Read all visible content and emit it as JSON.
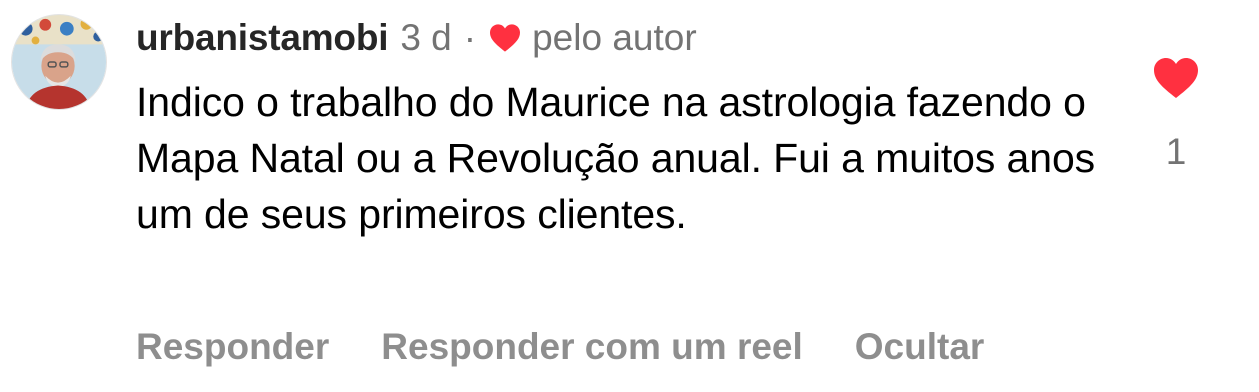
{
  "comment": {
    "username": "urbanistamobi",
    "time": "3 d",
    "separator": "·",
    "author_liked_label": "pelo autor",
    "text": "Indico o trabalho do Maurice na astrologia fazendo o Mapa Natal ou a Revolução anual. Fui a muitos anos um de seus primeiros clientes.",
    "like_count": "1",
    "liked": true,
    "heart_color": "#ff3040",
    "actions": {
      "reply": "Responder",
      "reply_with_reel": "Responder com um reel",
      "hide": "Ocultar"
    }
  }
}
